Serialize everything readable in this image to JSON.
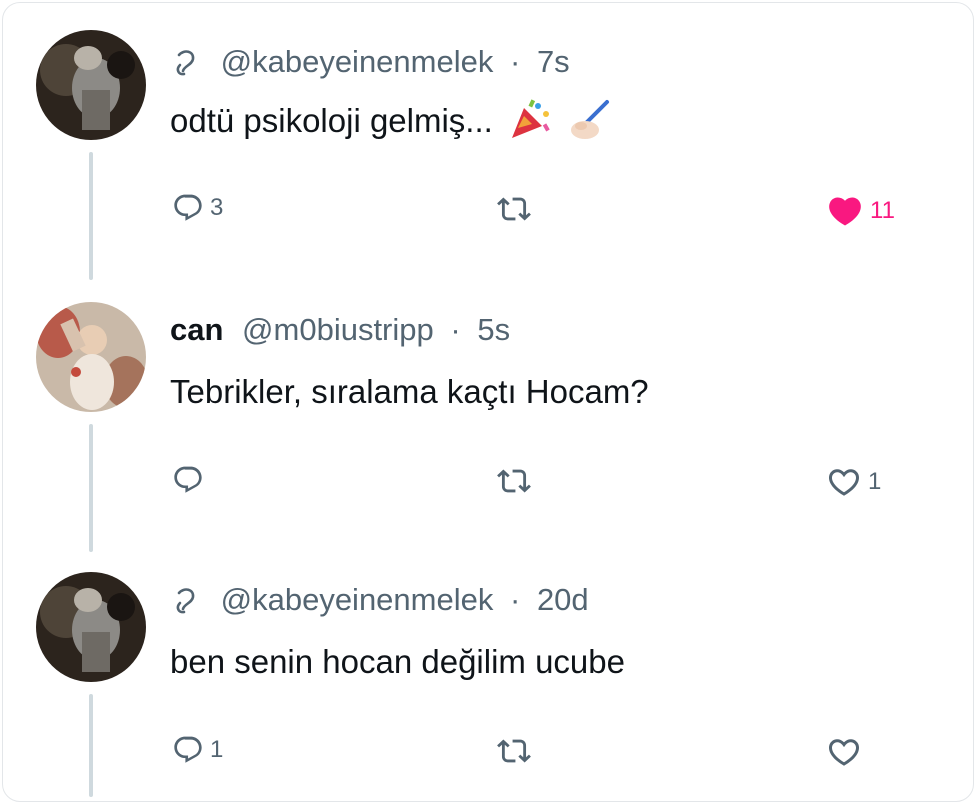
{
  "tweets": [
    {
      "name": "",
      "handle": "@kabeyeinenmelek",
      "time": "7s",
      "text": "odtü psikoloji gelmiş...",
      "emojis": [
        "party-popper-emoji",
        "writing-hand-emoji"
      ],
      "replies": "3",
      "retweets": "",
      "likes": "11",
      "liked": true
    },
    {
      "name": "can",
      "handle": "@m0biustripp",
      "time": "5s",
      "text": "Tebrikler, sıralama kaçtı Hocam?",
      "replies": "",
      "retweets": "",
      "likes": "1",
      "liked": false
    },
    {
      "name": "",
      "handle": "@kabeyeinenmelek",
      "time": "20d",
      "text": "ben senin hocan değilim ucube",
      "replies": "1",
      "retweets": "",
      "likes": "",
      "liked": false
    }
  ],
  "dot_separator": "·",
  "colors": {
    "like": "#f91880",
    "muted": "#536471",
    "thread_line": "#cfd9de"
  },
  "icons": {
    "reply": "reply-icon",
    "retweet": "retweet-icon",
    "like": "heart-icon",
    "badge": "custom-badge-icon"
  }
}
